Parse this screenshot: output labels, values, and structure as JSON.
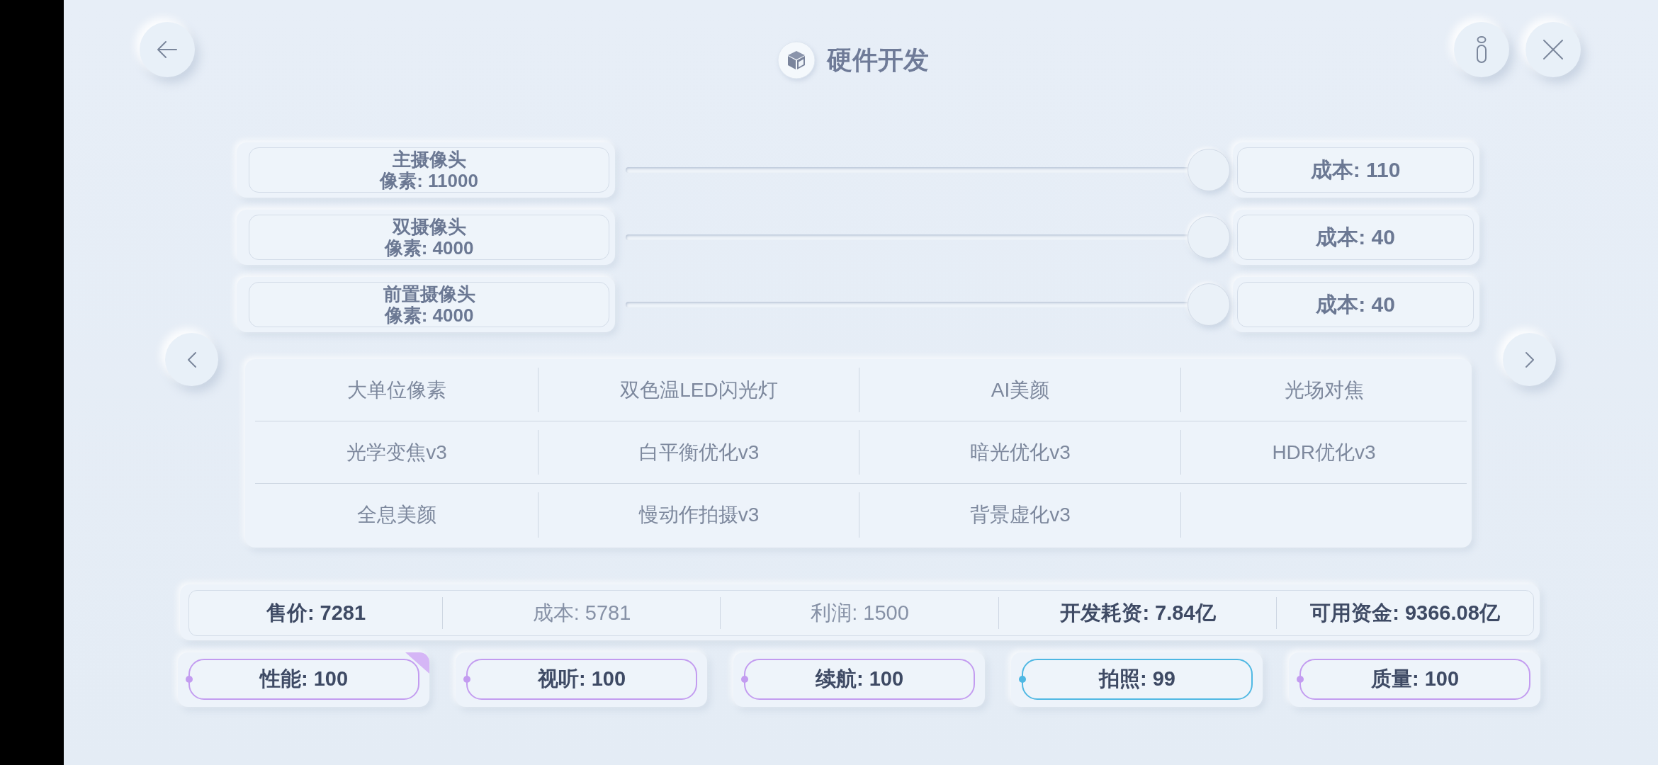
{
  "header": {
    "title": "硬件开发"
  },
  "sliders": [
    {
      "name": "主摄像头",
      "detail": "像素: 11000",
      "level": 1,
      "cost": "成本: 110"
    },
    {
      "name": "双摄像头",
      "detail": "像素: 4000",
      "level": 1,
      "cost": "成本: 40"
    },
    {
      "name": "前置摄像头",
      "detail": "像素: 4000",
      "level": 1,
      "cost": "成本: 40"
    }
  ],
  "features": [
    "大单位像素",
    "双色温LED闪光灯",
    "AI美颜",
    "光场对焦",
    "光学变焦v3",
    "白平衡优化v3",
    "暗光优化v3",
    "HDR优化v3",
    "全息美颜",
    "慢动作拍摄v3",
    "背景虚化v3"
  ],
  "summary": [
    {
      "text": "售价: 7281",
      "dimmed": false
    },
    {
      "text": "成本: 5781",
      "dimmed": true
    },
    {
      "text": "利润: 1500",
      "dimmed": true
    },
    {
      "text": "开发耗资: 7.84亿",
      "dimmed": false
    },
    {
      "text": "可用资金: 9366.08亿",
      "dimmed": false
    }
  ],
  "attributes": [
    {
      "label": "性能: 100",
      "color": "#c39cf0",
      "flagged": true
    },
    {
      "label": "视听: 100",
      "color": "#c39cf0",
      "flagged": false
    },
    {
      "label": "续航: 100",
      "color": "#c39cf0",
      "flagged": false
    },
    {
      "label": "拍照: 99",
      "color": "#4fb8e3",
      "flagged": false
    },
    {
      "label": "质量: 100",
      "color": "#c39cf0",
      "flagged": false
    }
  ]
}
